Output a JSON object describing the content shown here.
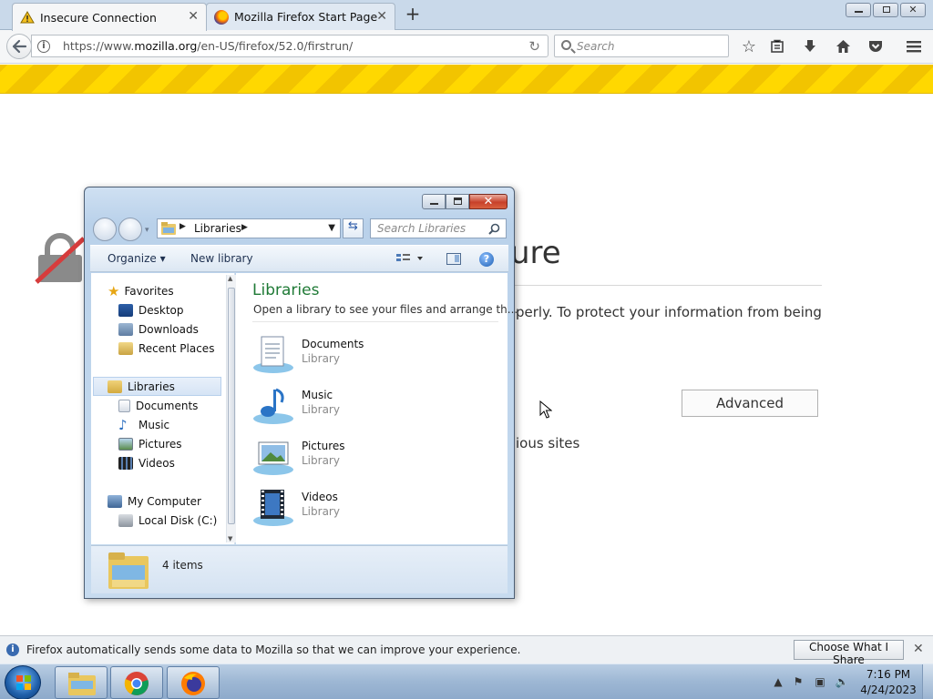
{
  "browser": {
    "tabs": [
      {
        "title": "Insecure Connection",
        "icon": "warning-icon",
        "active": true
      },
      {
        "title": "Mozilla Firefox Start Page",
        "icon": "firefox-icon",
        "active": false
      }
    ],
    "url_prefix": "https://www.",
    "url_host": "mozilla.org",
    "url_path": "/en-US/firefox/52.0/firstrun/",
    "search_placeholder": "Search",
    "toolbar_icons": [
      "bookmark-star-icon",
      "reading-list-icon",
      "download-icon",
      "home-icon",
      "pocket-icon",
      "menu-icon"
    ]
  },
  "error_page": {
    "title_fragment": "ure",
    "desc_fragment": "perly. To protect your information from being",
    "extra_fragment": "ious sites",
    "advanced_label": "Advanced",
    "stripe_colors": [
      "#ffd800",
      "#f2c400"
    ]
  },
  "explorer": {
    "address": "Libraries",
    "search_placeholder": "Search Libraries",
    "toolbar": {
      "organize": "Organize",
      "new_library": "New library"
    },
    "nav": {
      "favorites": {
        "label": "Favorites",
        "items": [
          "Desktop",
          "Downloads",
          "Recent Places"
        ]
      },
      "libraries": {
        "label": "Libraries",
        "items": [
          "Documents",
          "Music",
          "Pictures",
          "Videos"
        ]
      },
      "computer": {
        "label": "My Computer",
        "items": [
          "Local Disk (C:)"
        ]
      }
    },
    "main": {
      "heading": "Libraries",
      "subheading": "Open a library to see your files and arrange th...",
      "items": [
        {
          "name": "Documents",
          "type": "Library"
        },
        {
          "name": "Music",
          "type": "Library"
        },
        {
          "name": "Pictures",
          "type": "Library"
        },
        {
          "name": "Videos",
          "type": "Library"
        }
      ]
    },
    "status": "4 items"
  },
  "notification": {
    "text": "Firefox automatically sends some data to Mozilla so that we can improve your experience.",
    "button": "Choose What I Share"
  },
  "taskbar": {
    "apps": [
      "explorer-icon",
      "chrome-icon",
      "firefox-icon"
    ],
    "time": "7:16 PM",
    "date": "4/24/2023"
  }
}
